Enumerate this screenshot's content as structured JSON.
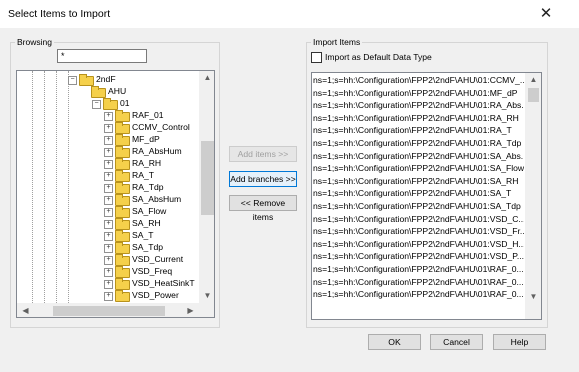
{
  "window": {
    "title": "Select Items to Import",
    "close_glyph": "✕"
  },
  "browsing": {
    "label": "Browsing",
    "filter_value": "*",
    "tree": [
      {
        "label": "2ndF",
        "level": 0,
        "expander": "−",
        "open": true
      },
      {
        "label": "AHU",
        "level": 1,
        "expander": "",
        "open": true
      },
      {
        "label": "01",
        "level": 2,
        "expander": "−",
        "open": true
      },
      {
        "label": "RAF_01",
        "level": 3,
        "expander": "+"
      },
      {
        "label": "CCMV_Control",
        "level": 3,
        "expander": "+"
      },
      {
        "label": "MF_dP",
        "level": 3,
        "expander": "+"
      },
      {
        "label": "RA_AbsHum",
        "level": 3,
        "expander": "+"
      },
      {
        "label": "RA_RH",
        "level": 3,
        "expander": "+"
      },
      {
        "label": "RA_T",
        "level": 3,
        "expander": "+"
      },
      {
        "label": "RA_Tdp",
        "level": 3,
        "expander": "+"
      },
      {
        "label": "SA_AbsHum",
        "level": 3,
        "expander": "+"
      },
      {
        "label": "SA_Flow",
        "level": 3,
        "expander": "+"
      },
      {
        "label": "SA_RH",
        "level": 3,
        "expander": "+"
      },
      {
        "label": "SA_T",
        "level": 3,
        "expander": "+"
      },
      {
        "label": "SA_Tdp",
        "level": 3,
        "expander": "+"
      },
      {
        "label": "VSD_Current",
        "level": 3,
        "expander": "+"
      },
      {
        "label": "VSD_Freq",
        "level": 3,
        "expander": "+"
      },
      {
        "label": "VSD_HeatSinkT",
        "level": 3,
        "expander": "+"
      },
      {
        "label": "VSD_Power",
        "level": 3,
        "expander": "+"
      }
    ]
  },
  "buttons": {
    "add_items": "Add items >>",
    "add_branches": "Add branches >>",
    "remove_items": "<< Remove items",
    "ok": "OK",
    "cancel": "Cancel",
    "help": "Help"
  },
  "import_items": {
    "label": "Import Items",
    "default_type_label": "Import as Default Data Type",
    "default_type_checked": false,
    "items": [
      "ns=1;s=hh:\\Configuration\\FPP2\\2ndF\\AHU\\01:CCMV_...",
      "ns=1;s=hh:\\Configuration\\FPP2\\2ndF\\AHU\\01:MF_dP",
      "ns=1;s=hh:\\Configuration\\FPP2\\2ndF\\AHU\\01:RA_Abs...",
      "ns=1;s=hh:\\Configuration\\FPP2\\2ndF\\AHU\\01:RA_RH",
      "ns=1;s=hh:\\Configuration\\FPP2\\2ndF\\AHU\\01:RA_T",
      "ns=1;s=hh:\\Configuration\\FPP2\\2ndF\\AHU\\01:RA_Tdp",
      "ns=1;s=hh:\\Configuration\\FPP2\\2ndF\\AHU\\01:SA_Abs...",
      "ns=1;s=hh:\\Configuration\\FPP2\\2ndF\\AHU\\01:SA_Flow",
      "ns=1;s=hh:\\Configuration\\FPP2\\2ndF\\AHU\\01:SA_RH",
      "ns=1;s=hh:\\Configuration\\FPP2\\2ndF\\AHU\\01:SA_T",
      "ns=1;s=hh:\\Configuration\\FPP2\\2ndF\\AHU\\01:SA_Tdp",
      "ns=1;s=hh:\\Configuration\\FPP2\\2ndF\\AHU\\01:VSD_C...",
      "ns=1;s=hh:\\Configuration\\FPP2\\2ndF\\AHU\\01:VSD_Fr...",
      "ns=1;s=hh:\\Configuration\\FPP2\\2ndF\\AHU\\01:VSD_H...",
      "ns=1;s=hh:\\Configuration\\FPP2\\2ndF\\AHU\\01:VSD_P...",
      "ns=1;s=hh:\\Configuration\\FPP2\\2ndF\\AHU\\01\\RAF_0...",
      "ns=1;s=hh:\\Configuration\\FPP2\\2ndF\\AHU\\01\\RAF_0...",
      "ns=1;s=hh:\\Configuration\\FPP2\\2ndF\\AHU\\01\\RAF_0..."
    ]
  },
  "scroll": {
    "up": "▲",
    "down": "▼",
    "left": "◀",
    "right": "▶"
  },
  "colors": {
    "accent": "#0078d7",
    "folder": "#f5d04b",
    "dialog_bg": "#f0f0f0"
  }
}
